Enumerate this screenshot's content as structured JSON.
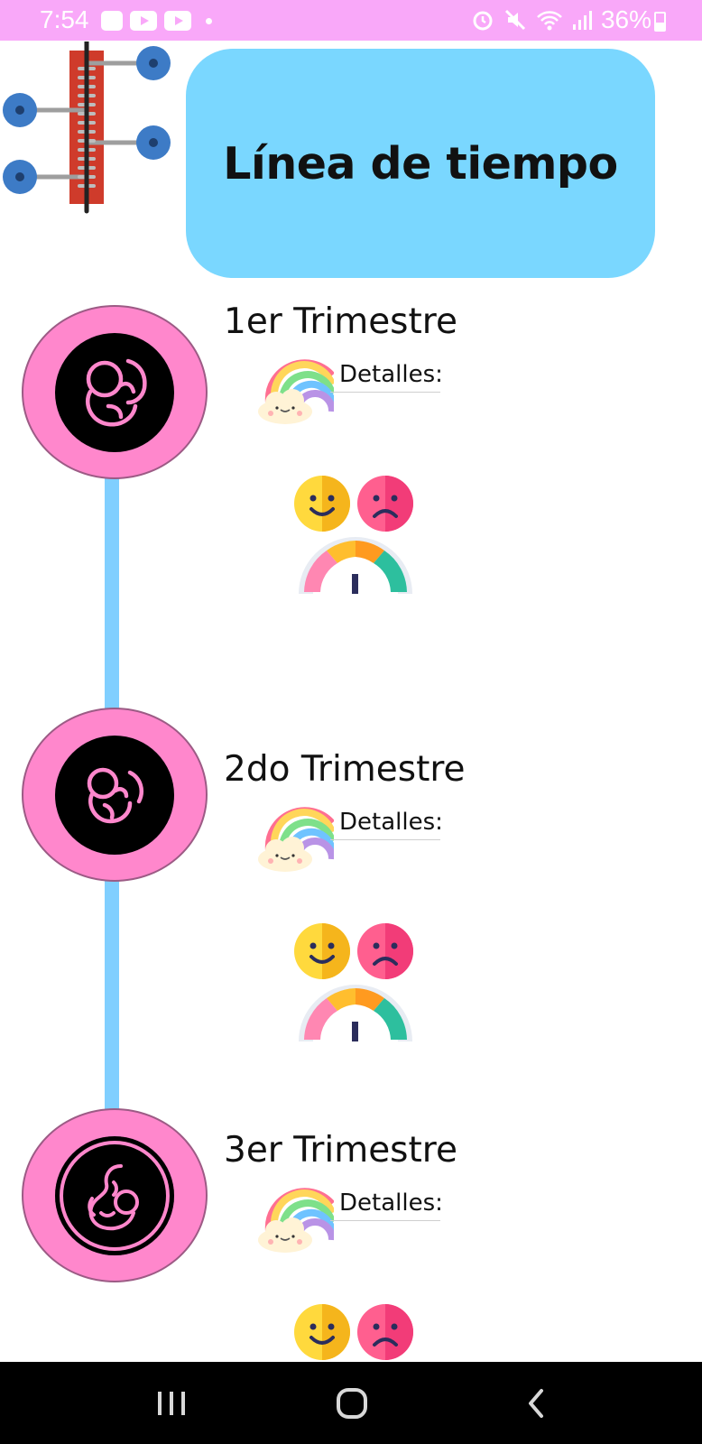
{
  "status_bar": {
    "time": "7:54",
    "battery": "36%",
    "background": "#f9a8f9"
  },
  "header": {
    "title": "Línea de tiempo",
    "card_color": "#7ad7ff"
  },
  "timeline": {
    "line_color": "#80cfff",
    "node_color": "#ff87cc",
    "stages": [
      {
        "title": "1er Trimestre",
        "details_label": "Detalles:"
      },
      {
        "title": "2do Trimestre",
        "details_label": "Detalles:"
      },
      {
        "title": "3er Trimestre",
        "details_label": "Detalles:"
      }
    ]
  },
  "nav": {
    "recents": "recents-icon",
    "home": "home-icon",
    "back": "back-icon"
  }
}
